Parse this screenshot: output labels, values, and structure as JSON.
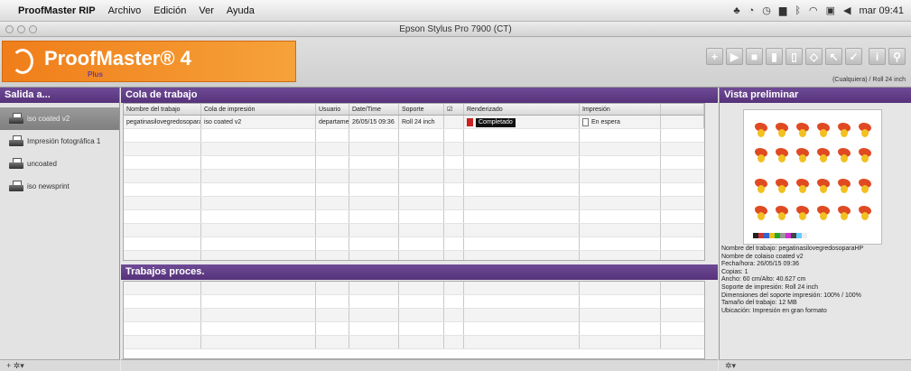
{
  "menubar": {
    "app_name": "ProofMaster RIP",
    "menus": [
      "Archivo",
      "Edición",
      "Ver",
      "Ayuda"
    ],
    "clock": "mar 09:41"
  },
  "window": {
    "title": "Epson Stylus Pro 7900 (CT)"
  },
  "logo": {
    "name": "ProofMaster® 4",
    "edition": "Plus"
  },
  "toolbar": {
    "media": "(Cualquiera) / Roll 24 inch"
  },
  "left_panel": {
    "title": "Salida a...",
    "queues": [
      "iso coated v2",
      "Impresión fotográfica 1",
      "uncoated",
      "iso newsprint"
    ]
  },
  "work_queue": {
    "title": "Cola de trabajo",
    "columns": [
      "Nombre del trabajo",
      "Cola de impresión",
      "Usuario",
      "Date/Time",
      "Soporte",
      "",
      "Renderizado",
      "Impresión"
    ],
    "rows": [
      {
        "name": "pegatinasilovegredosopara",
        "queue": "iso coated v2",
        "user": "departamen",
        "datetime": "26/05/15 09:36",
        "media": "Roll 24 inch",
        "render": "Completado",
        "print": "En espera"
      }
    ]
  },
  "processed": {
    "title": "Trabajos proces."
  },
  "preview": {
    "title": "Vista preliminar",
    "info": [
      "Nombre del trabajo: pegatinasilovegredosoparaHP",
      "Nombre de colaiso coated v2",
      "Fecha/hora: 26/05/15 09:36",
      "Copias: 1",
      "Ancho: 60 cm/Alto: 40.627 cm",
      "Soporte de impresión: Roll 24 inch",
      "Dimensiones del soporte impresión: 100% / 100%",
      "Tamaño del trabajo: 12 MB",
      "Ubicación: Impresión en gran formato"
    ]
  },
  "bottom": {
    "left_controls": "+ ✲▾",
    "right_controls": "✲▾"
  }
}
